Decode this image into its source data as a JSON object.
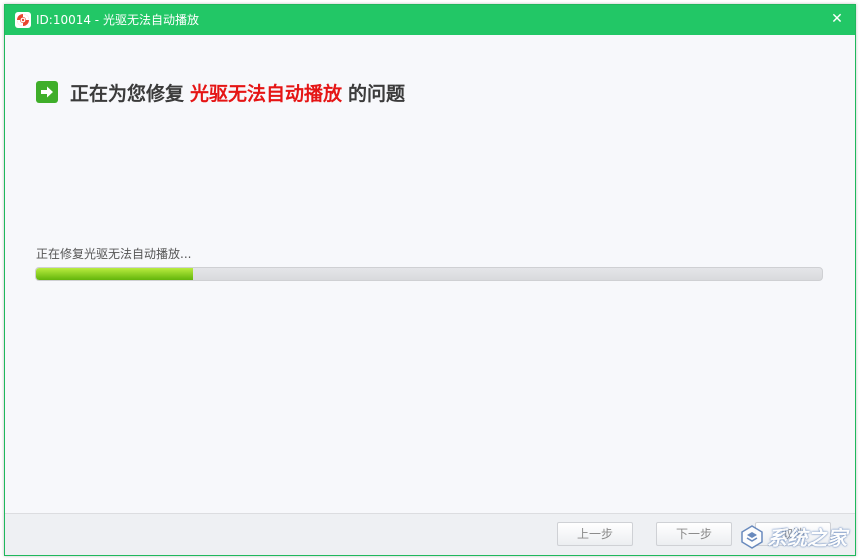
{
  "window": {
    "title": "ID:10014 - 光驱无法自动播放"
  },
  "heading": {
    "prefix": "正在为您修复",
    "highlight": "光驱无法自动播放",
    "suffix": "的问题"
  },
  "progress": {
    "label": "正在修复光驱无法自动播放...",
    "fraction": 0.2
  },
  "footer": {
    "prev_label": "上一步",
    "next_label": "下一步",
    "cancel_label": "取消"
  },
  "watermark": {
    "text": "系统之家"
  },
  "colors": {
    "titlebar": "#22c766",
    "highlight": "#e51515",
    "progress_fill": "#7fcd16"
  },
  "icons": {
    "app": "lifebuoy-icon",
    "close": "close-icon",
    "heading": "arrow-right-icon"
  }
}
